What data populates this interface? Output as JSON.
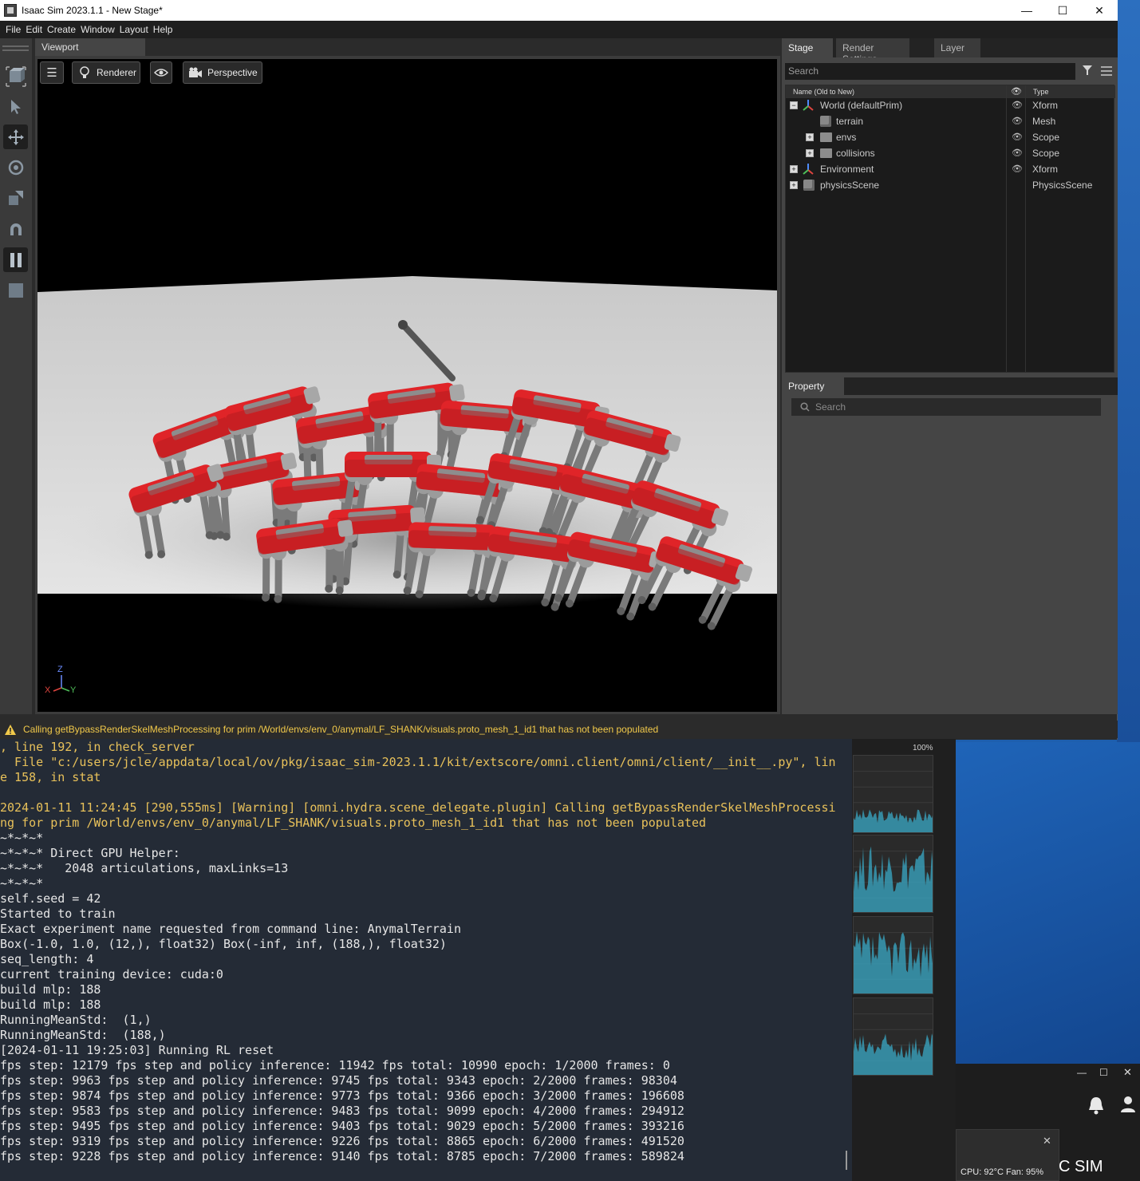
{
  "window": {
    "title": "Isaac Sim 2023.1.1 - New Stage*",
    "minimize": "—",
    "maximize": "☐",
    "close": "✕"
  },
  "menu": [
    "File",
    "Edit",
    "Create",
    "Window",
    "Layout",
    "Help"
  ],
  "viewport": {
    "tab": "Viewport",
    "renderer_label": "Renderer",
    "camera_label": "Perspective",
    "axis": {
      "z": "Z",
      "x": "X",
      "y": "Y"
    }
  },
  "stage": {
    "tabs": [
      "Stage",
      "Render Settings",
      "Layer"
    ],
    "search_placeholder": "Search",
    "header_name": "Name (Old to New)",
    "header_type": "Type",
    "rows": [
      {
        "name": "World (defaultPrim)",
        "type": "Xform"
      },
      {
        "name": "terrain",
        "type": "Mesh"
      },
      {
        "name": "envs",
        "type": "Scope"
      },
      {
        "name": "collisions",
        "type": "Scope"
      },
      {
        "name": "Environment",
        "type": "Xform"
      },
      {
        "name": "physicsScene",
        "type": "PhysicsScene"
      }
    ]
  },
  "property": {
    "tab": "Property",
    "search_placeholder": "Search"
  },
  "status": {
    "message": "Calling getBypassRenderSkelMeshProcessing for prim /World/envs/env_0/anymal/LF_SHANK/visuals.proto_mesh_1_id1 that has not been populated"
  },
  "terminal": {
    "lines": [
      {
        "text": ", line 192, in check_server",
        "warn": true
      },
      {
        "text": "  File \"c:/users/jcle/appdata/local/ov/pkg/isaac_sim-2023.1.1/kit/extscore/omni.client/omni/client/__init__.py\", lin",
        "warn": true
      },
      {
        "text": "e 158, in stat",
        "warn": true
      },
      {
        "text": "",
        "warn": false
      },
      {
        "text": "2024-01-11 11:24:45 [290,555ms] [Warning] [omni.hydra.scene_delegate.plugin] Calling getBypassRenderSkelMeshProcessi",
        "warn": true
      },
      {
        "text": "ng for prim /World/envs/env_0/anymal/LF_SHANK/visuals.proto_mesh_1_id1 that has not been populated",
        "warn": true
      },
      {
        "text": "~*~*~*",
        "warn": false
      },
      {
        "text": "~*~*~* Direct GPU Helper:",
        "warn": false
      },
      {
        "text": "~*~*~*   2048 articulations, maxLinks=13",
        "warn": false
      },
      {
        "text": "~*~*~*",
        "warn": false
      },
      {
        "text": "self.seed = 42",
        "warn": false
      },
      {
        "text": "Started to train",
        "warn": false
      },
      {
        "text": "Exact experiment name requested from command line: AnymalTerrain",
        "warn": false
      },
      {
        "text": "Box(-1.0, 1.0, (12,), float32) Box(-inf, inf, (188,), float32)",
        "warn": false
      },
      {
        "text": "seq_length: 4",
        "warn": false
      },
      {
        "text": "current training device: cuda:0",
        "warn": false
      },
      {
        "text": "build mlp: 188",
        "warn": false
      },
      {
        "text": "build mlp: 188",
        "warn": false
      },
      {
        "text": "RunningMeanStd:  (1,)",
        "warn": false
      },
      {
        "text": "RunningMeanStd:  (188,)",
        "warn": false
      },
      {
        "text": "[2024-01-11 19:25:03] Running RL reset",
        "warn": false
      },
      {
        "text": "fps step: 12179 fps step and policy inference: 11942 fps total: 10990 epoch: 1/2000 frames: 0",
        "warn": false
      },
      {
        "text": "fps step: 9963 fps step and policy inference: 9745 fps total: 9343 epoch: 2/2000 frames: 98304",
        "warn": false
      },
      {
        "text": "fps step: 9874 fps step and policy inference: 9773 fps total: 9366 epoch: 3/2000 frames: 196608",
        "warn": false
      },
      {
        "text": "fps step: 9583 fps step and policy inference: 9483 fps total: 9099 epoch: 4/2000 frames: 294912",
        "warn": false
      },
      {
        "text": "fps step: 9495 fps step and policy inference: 9403 fps total: 9029 epoch: 5/2000 frames: 393216",
        "warn": false
      },
      {
        "text": "fps step: 9319 fps step and policy inference: 9226 fps total: 8865 epoch: 6/2000 frames: 491520",
        "warn": false
      },
      {
        "text": "fps step: 9228 fps step and policy inference: 9140 fps total: 8785 epoch: 7/2000 frames: 589824",
        "warn": false
      }
    ]
  },
  "taskmgr": {
    "percent": "100%"
  },
  "tray": {
    "cpu": "CPU: 92°C Fan: 95%",
    "sim": "C SIM"
  },
  "colors": {
    "accent_red": "#e02428",
    "graph_cyan": "#3aa9c7",
    "warning_yellow": "#f1c94a"
  }
}
